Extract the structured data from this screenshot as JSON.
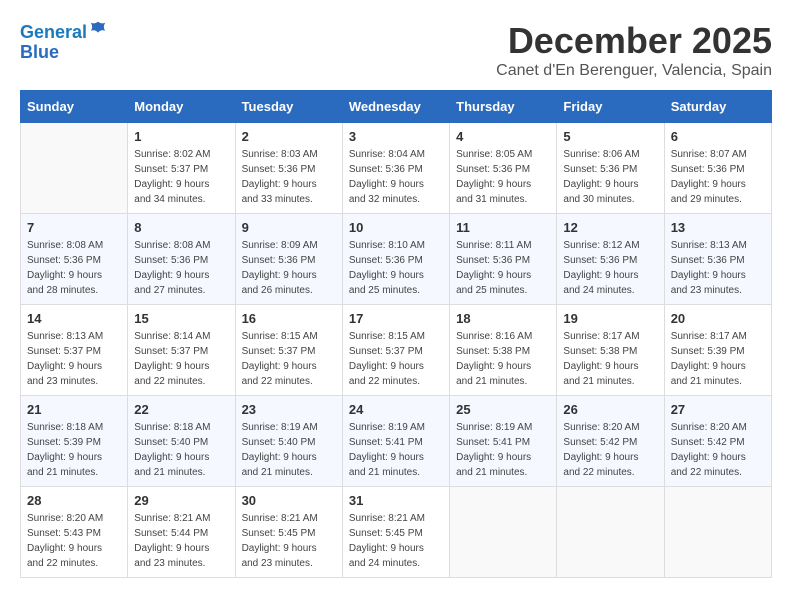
{
  "header": {
    "logo_line1": "General",
    "logo_line2": "Blue",
    "month_title": "December 2025",
    "location": "Canet d'En Berenguer, Valencia, Spain"
  },
  "days_of_week": [
    "Sunday",
    "Monday",
    "Tuesday",
    "Wednesday",
    "Thursday",
    "Friday",
    "Saturday"
  ],
  "weeks": [
    [
      {
        "day": "",
        "info": ""
      },
      {
        "day": "1",
        "info": "Sunrise: 8:02 AM\nSunset: 5:37 PM\nDaylight: 9 hours\nand 34 minutes."
      },
      {
        "day": "2",
        "info": "Sunrise: 8:03 AM\nSunset: 5:36 PM\nDaylight: 9 hours\nand 33 minutes."
      },
      {
        "day": "3",
        "info": "Sunrise: 8:04 AM\nSunset: 5:36 PM\nDaylight: 9 hours\nand 32 minutes."
      },
      {
        "day": "4",
        "info": "Sunrise: 8:05 AM\nSunset: 5:36 PM\nDaylight: 9 hours\nand 31 minutes."
      },
      {
        "day": "5",
        "info": "Sunrise: 8:06 AM\nSunset: 5:36 PM\nDaylight: 9 hours\nand 30 minutes."
      },
      {
        "day": "6",
        "info": "Sunrise: 8:07 AM\nSunset: 5:36 PM\nDaylight: 9 hours\nand 29 minutes."
      }
    ],
    [
      {
        "day": "7",
        "info": "Sunrise: 8:08 AM\nSunset: 5:36 PM\nDaylight: 9 hours\nand 28 minutes."
      },
      {
        "day": "8",
        "info": "Sunrise: 8:08 AM\nSunset: 5:36 PM\nDaylight: 9 hours\nand 27 minutes."
      },
      {
        "day": "9",
        "info": "Sunrise: 8:09 AM\nSunset: 5:36 PM\nDaylight: 9 hours\nand 26 minutes."
      },
      {
        "day": "10",
        "info": "Sunrise: 8:10 AM\nSunset: 5:36 PM\nDaylight: 9 hours\nand 25 minutes."
      },
      {
        "day": "11",
        "info": "Sunrise: 8:11 AM\nSunset: 5:36 PM\nDaylight: 9 hours\nand 25 minutes."
      },
      {
        "day": "12",
        "info": "Sunrise: 8:12 AM\nSunset: 5:36 PM\nDaylight: 9 hours\nand 24 minutes."
      },
      {
        "day": "13",
        "info": "Sunrise: 8:13 AM\nSunset: 5:36 PM\nDaylight: 9 hours\nand 23 minutes."
      }
    ],
    [
      {
        "day": "14",
        "info": "Sunrise: 8:13 AM\nSunset: 5:37 PM\nDaylight: 9 hours\nand 23 minutes."
      },
      {
        "day": "15",
        "info": "Sunrise: 8:14 AM\nSunset: 5:37 PM\nDaylight: 9 hours\nand 22 minutes."
      },
      {
        "day": "16",
        "info": "Sunrise: 8:15 AM\nSunset: 5:37 PM\nDaylight: 9 hours\nand 22 minutes."
      },
      {
        "day": "17",
        "info": "Sunrise: 8:15 AM\nSunset: 5:37 PM\nDaylight: 9 hours\nand 22 minutes."
      },
      {
        "day": "18",
        "info": "Sunrise: 8:16 AM\nSunset: 5:38 PM\nDaylight: 9 hours\nand 21 minutes."
      },
      {
        "day": "19",
        "info": "Sunrise: 8:17 AM\nSunset: 5:38 PM\nDaylight: 9 hours\nand 21 minutes."
      },
      {
        "day": "20",
        "info": "Sunrise: 8:17 AM\nSunset: 5:39 PM\nDaylight: 9 hours\nand 21 minutes."
      }
    ],
    [
      {
        "day": "21",
        "info": "Sunrise: 8:18 AM\nSunset: 5:39 PM\nDaylight: 9 hours\nand 21 minutes."
      },
      {
        "day": "22",
        "info": "Sunrise: 8:18 AM\nSunset: 5:40 PM\nDaylight: 9 hours\nand 21 minutes."
      },
      {
        "day": "23",
        "info": "Sunrise: 8:19 AM\nSunset: 5:40 PM\nDaylight: 9 hours\nand 21 minutes."
      },
      {
        "day": "24",
        "info": "Sunrise: 8:19 AM\nSunset: 5:41 PM\nDaylight: 9 hours\nand 21 minutes."
      },
      {
        "day": "25",
        "info": "Sunrise: 8:19 AM\nSunset: 5:41 PM\nDaylight: 9 hours\nand 21 minutes."
      },
      {
        "day": "26",
        "info": "Sunrise: 8:20 AM\nSunset: 5:42 PM\nDaylight: 9 hours\nand 22 minutes."
      },
      {
        "day": "27",
        "info": "Sunrise: 8:20 AM\nSunset: 5:42 PM\nDaylight: 9 hours\nand 22 minutes."
      }
    ],
    [
      {
        "day": "28",
        "info": "Sunrise: 8:20 AM\nSunset: 5:43 PM\nDaylight: 9 hours\nand 22 minutes."
      },
      {
        "day": "29",
        "info": "Sunrise: 8:21 AM\nSunset: 5:44 PM\nDaylight: 9 hours\nand 23 minutes."
      },
      {
        "day": "30",
        "info": "Sunrise: 8:21 AM\nSunset: 5:45 PM\nDaylight: 9 hours\nand 23 minutes."
      },
      {
        "day": "31",
        "info": "Sunrise: 8:21 AM\nSunset: 5:45 PM\nDaylight: 9 hours\nand 24 minutes."
      },
      {
        "day": "",
        "info": ""
      },
      {
        "day": "",
        "info": ""
      },
      {
        "day": "",
        "info": ""
      }
    ]
  ]
}
